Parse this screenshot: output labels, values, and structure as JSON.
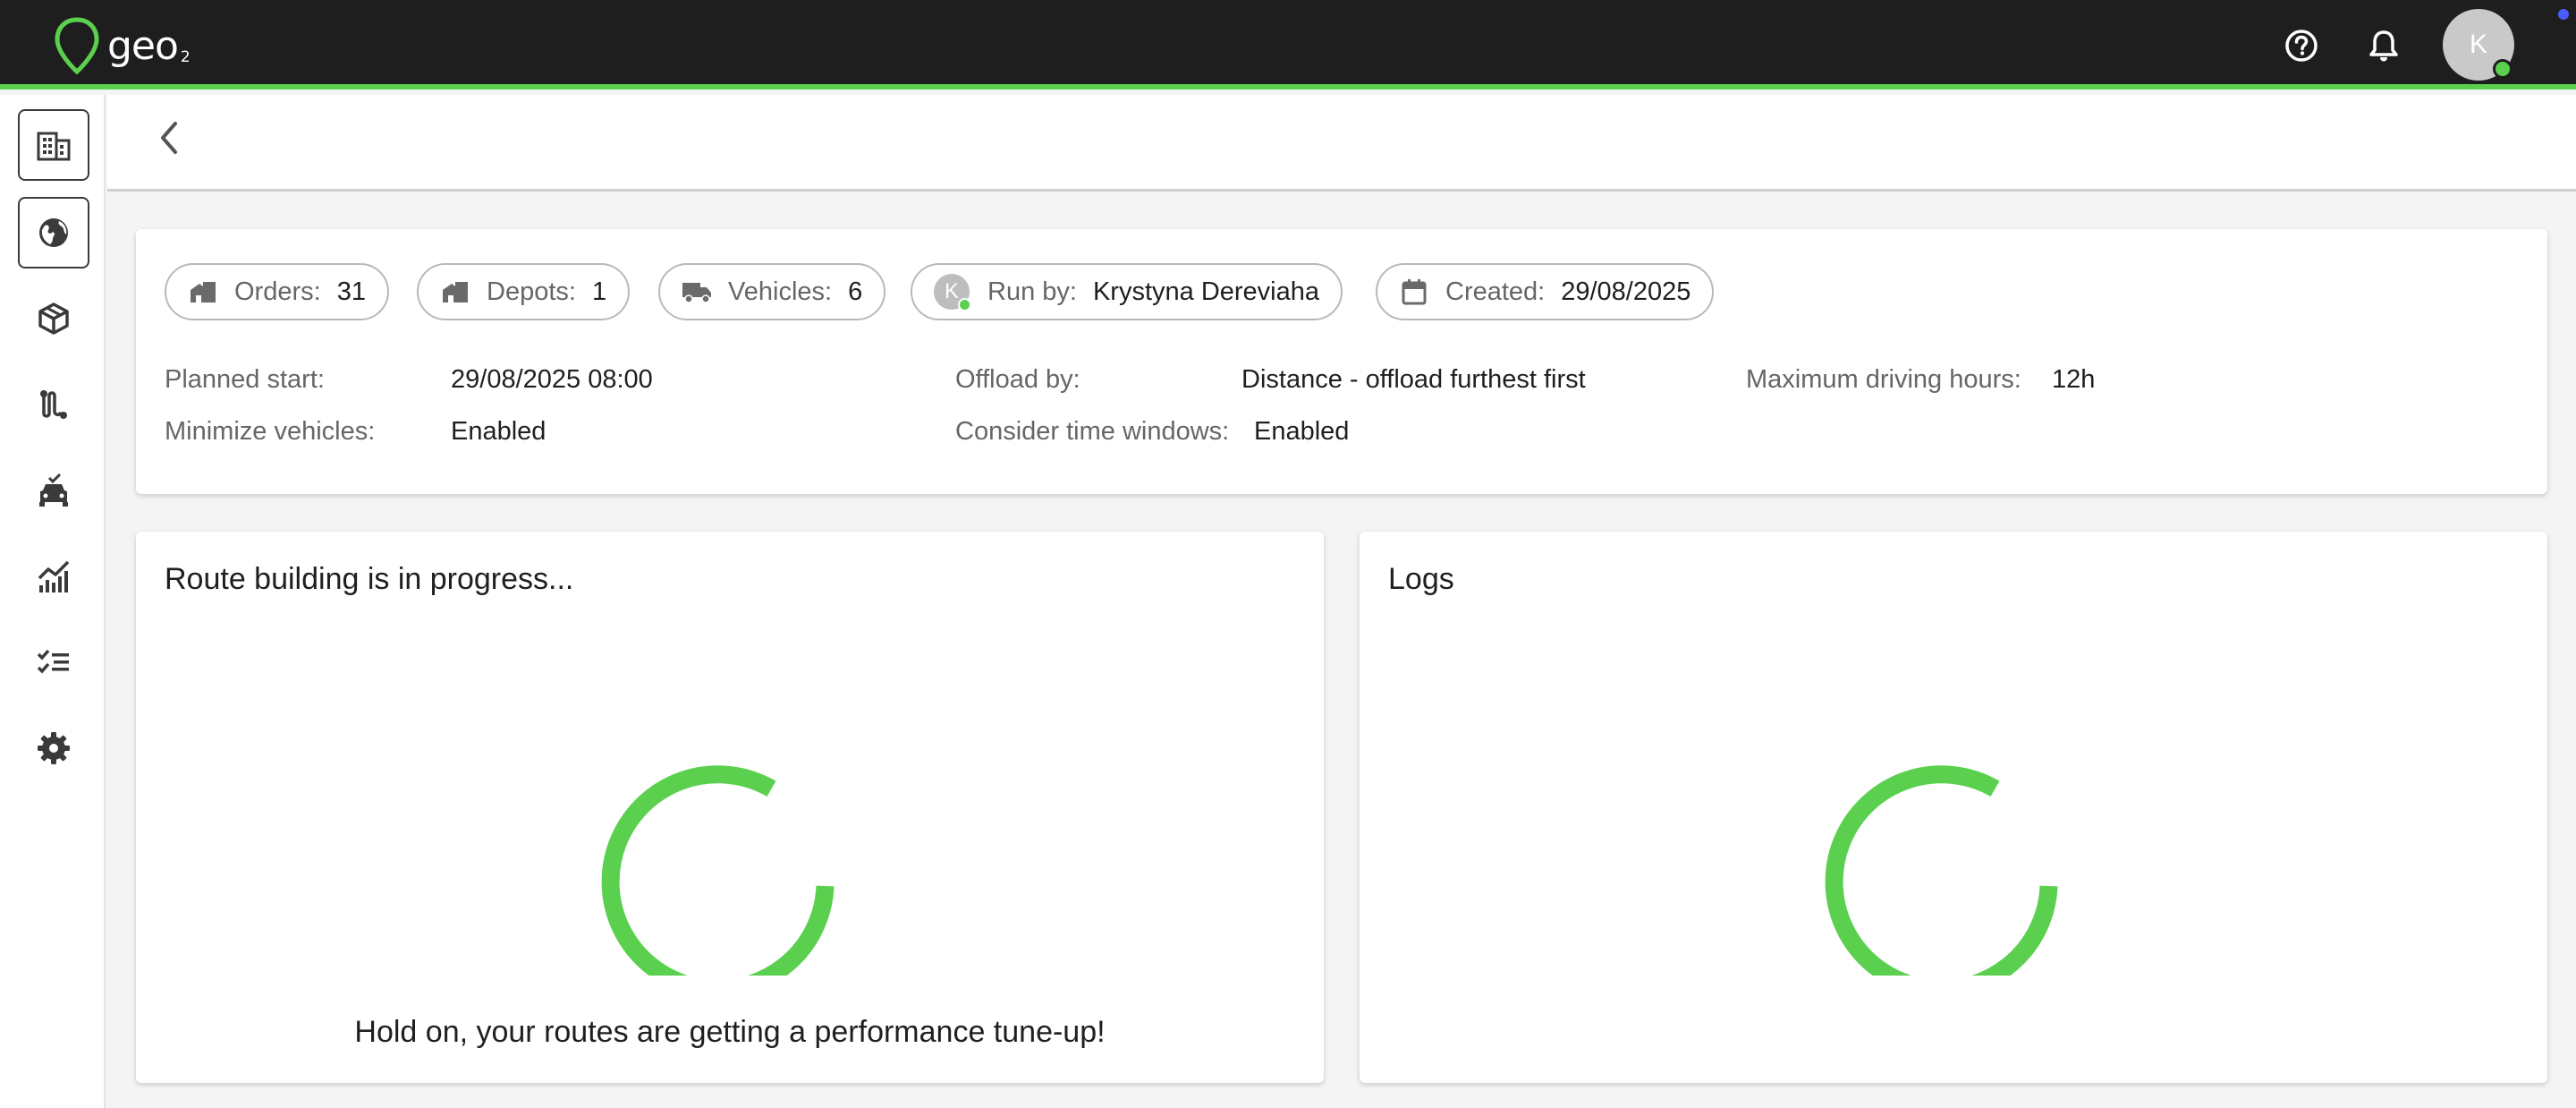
{
  "app": {
    "logo_text": "geo",
    "logo_sub": "2",
    "brand_color": "#5bd04f",
    "topbar_color": "#1e1e1e"
  },
  "topbar": {
    "help_icon": "help-circle-icon",
    "notifications_icon": "bell-icon",
    "user_initial": "K",
    "user_status": "online"
  },
  "sidebar": {
    "items": [
      {
        "name": "buildings-icon",
        "active": true
      },
      {
        "name": "globe-icon",
        "active": true
      },
      {
        "name": "package-icon",
        "active": false
      },
      {
        "name": "route-icon",
        "active": false
      },
      {
        "name": "vehicle-icon",
        "active": false
      },
      {
        "name": "analytics-icon",
        "active": false
      },
      {
        "name": "checklist-icon",
        "active": false
      },
      {
        "name": "settings-gear-icon",
        "active": false
      }
    ]
  },
  "header": {
    "back_icon": "chevron-left-icon"
  },
  "summary": {
    "orders": {
      "label": "Orders:",
      "value": "31"
    },
    "depots": {
      "label": "Depots:",
      "value": "1"
    },
    "vehicles": {
      "label": "Vehicles:",
      "value": "6"
    },
    "run_by": {
      "label": "Run by:",
      "value": "Krystyna Dereviaha",
      "initial": "K"
    },
    "created": {
      "label": "Created:",
      "value": "29/08/2025"
    }
  },
  "params": {
    "planned_start": {
      "label": "Planned start:",
      "value": "29/08/2025 08:00"
    },
    "minimize_vehicles": {
      "label": "Minimize vehicles:",
      "value": "Enabled"
    },
    "offload_by": {
      "label": "Offload by:",
      "value": "Distance - offload furthest first"
    },
    "consider_time_windows": {
      "label": "Consider time windows:",
      "value": "Enabled"
    },
    "max_driving_hours": {
      "label": "Maximum driving hours:",
      "value": "12h"
    }
  },
  "progress": {
    "title": "Route building is in progress...",
    "message": "Hold on, your routes are getting a performance tune-up!",
    "spinner_color": "#5bd04f"
  },
  "logs": {
    "title": "Logs"
  }
}
